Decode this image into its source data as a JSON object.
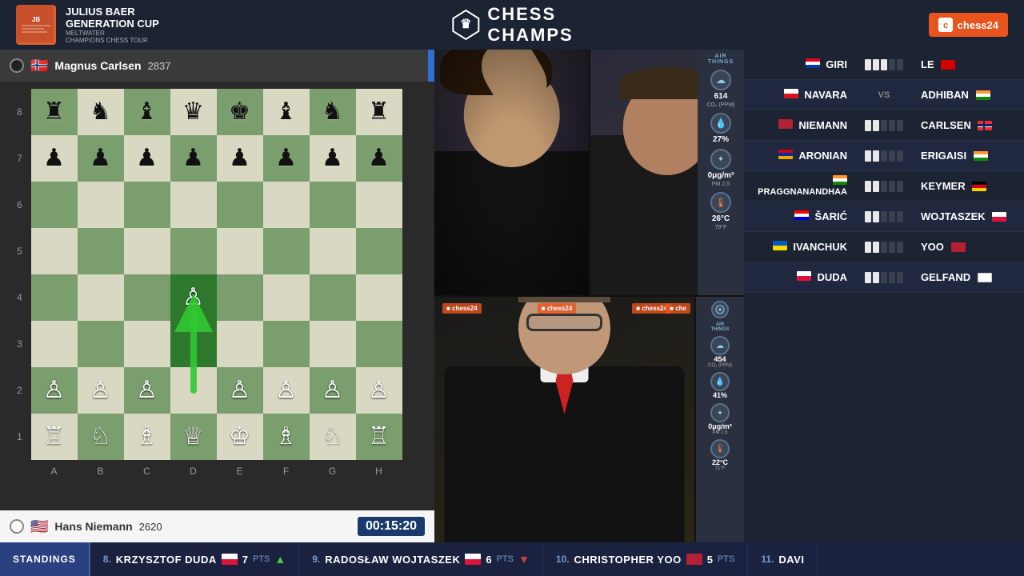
{
  "topBar": {
    "julius": {
      "line1": "JULIUS BAER",
      "line2": "GENERATION CUP",
      "line3": "MELTWATER",
      "line4": "CHAMPIONS CHESS TOUR"
    },
    "chessChamps": "CHESS CHAMPS",
    "chess24": "chess24"
  },
  "board": {
    "blackPlayer": {
      "name": "Magnus Carlsen",
      "rating": "2837",
      "flag": "🇳🇴"
    },
    "whitePlayer": {
      "name": "Hans Niemann",
      "rating": "2620",
      "flag": "🇺🇸"
    },
    "timer": "00:15:20",
    "files": [
      "A",
      "B",
      "C",
      "D",
      "E",
      "F",
      "G",
      "H"
    ],
    "ranks": [
      "8",
      "7",
      "6",
      "5",
      "4",
      "3",
      "2",
      "1"
    ]
  },
  "matchups": [
    {
      "left": "GIRI",
      "leftFlag": "nl",
      "right": "LE",
      "rightFlag": "vn",
      "type": "score"
    },
    {
      "left": "NAVARA",
      "leftFlag": "cz",
      "vs": "VS",
      "right": "ADHIBAN",
      "rightFlag": "in",
      "type": "vs"
    },
    {
      "left": "NIEMANN",
      "leftFlag": "us",
      "right": "CARLSEN",
      "rightFlag": "no",
      "type": "score"
    },
    {
      "left": "ARONIAN",
      "leftFlag": "arm",
      "right": "ERIGAISI",
      "rightFlag": "in",
      "type": "score"
    },
    {
      "left": "PRAGGNANANDHAA",
      "leftFlag": "in",
      "right": "KEYMER",
      "rightFlag": "de",
      "type": "score"
    },
    {
      "left": "ŠARIĆ",
      "leftFlag": "hr",
      "right": "WOJTASZEK",
      "rightFlag": "pl",
      "type": "score"
    },
    {
      "left": "IVANCHUK",
      "leftFlag": "ua",
      "right": "YOO",
      "rightFlag": "us",
      "type": "score"
    },
    {
      "left": "DUDA",
      "leftFlag": "pl",
      "right": "GELFAND",
      "rightFlag": "il",
      "type": "score"
    }
  ],
  "airthings": {
    "label": "AIRTHINGS",
    "co2": {
      "value": "614",
      "unit": "CO₂ (PPM)"
    },
    "humidity": {
      "value": "27%"
    },
    "pm": {
      "value": "0μg/m³",
      "unit": "PM 2.5"
    },
    "temp1": {
      "value": "26°C",
      "unit": "79°F"
    },
    "comm_co2": {
      "value": "454",
      "unit": "CO₂ (PPM)"
    },
    "comm_humidity": {
      "value": "41%"
    },
    "comm_pm": {
      "value": "0μg/m³",
      "unit": "PM 2.5"
    },
    "comm_temp": {
      "value": "22°C",
      "unit": "71°F"
    }
  },
  "ticker": {
    "label": "STANDINGS",
    "items": [
      {
        "rank": "8.",
        "name": "KRZYSZTOF DUDA",
        "flag": "pl",
        "pts": "7",
        "pts_label": "PTS",
        "trend": "up"
      },
      {
        "rank": "9.",
        "name": "RADOSŁAW WOJTASZEK",
        "flag": "pl",
        "pts": "6",
        "pts_label": "PTS",
        "trend": "down"
      },
      {
        "rank": "10.",
        "name": "CHRISTOPHER YOO",
        "flag": "us",
        "pts": "5",
        "pts_label": "PTS",
        "trend": ""
      },
      {
        "rank": "11.",
        "name": "DAVI",
        "flag": "",
        "pts": "",
        "pts_label": "",
        "trend": ""
      }
    ]
  }
}
